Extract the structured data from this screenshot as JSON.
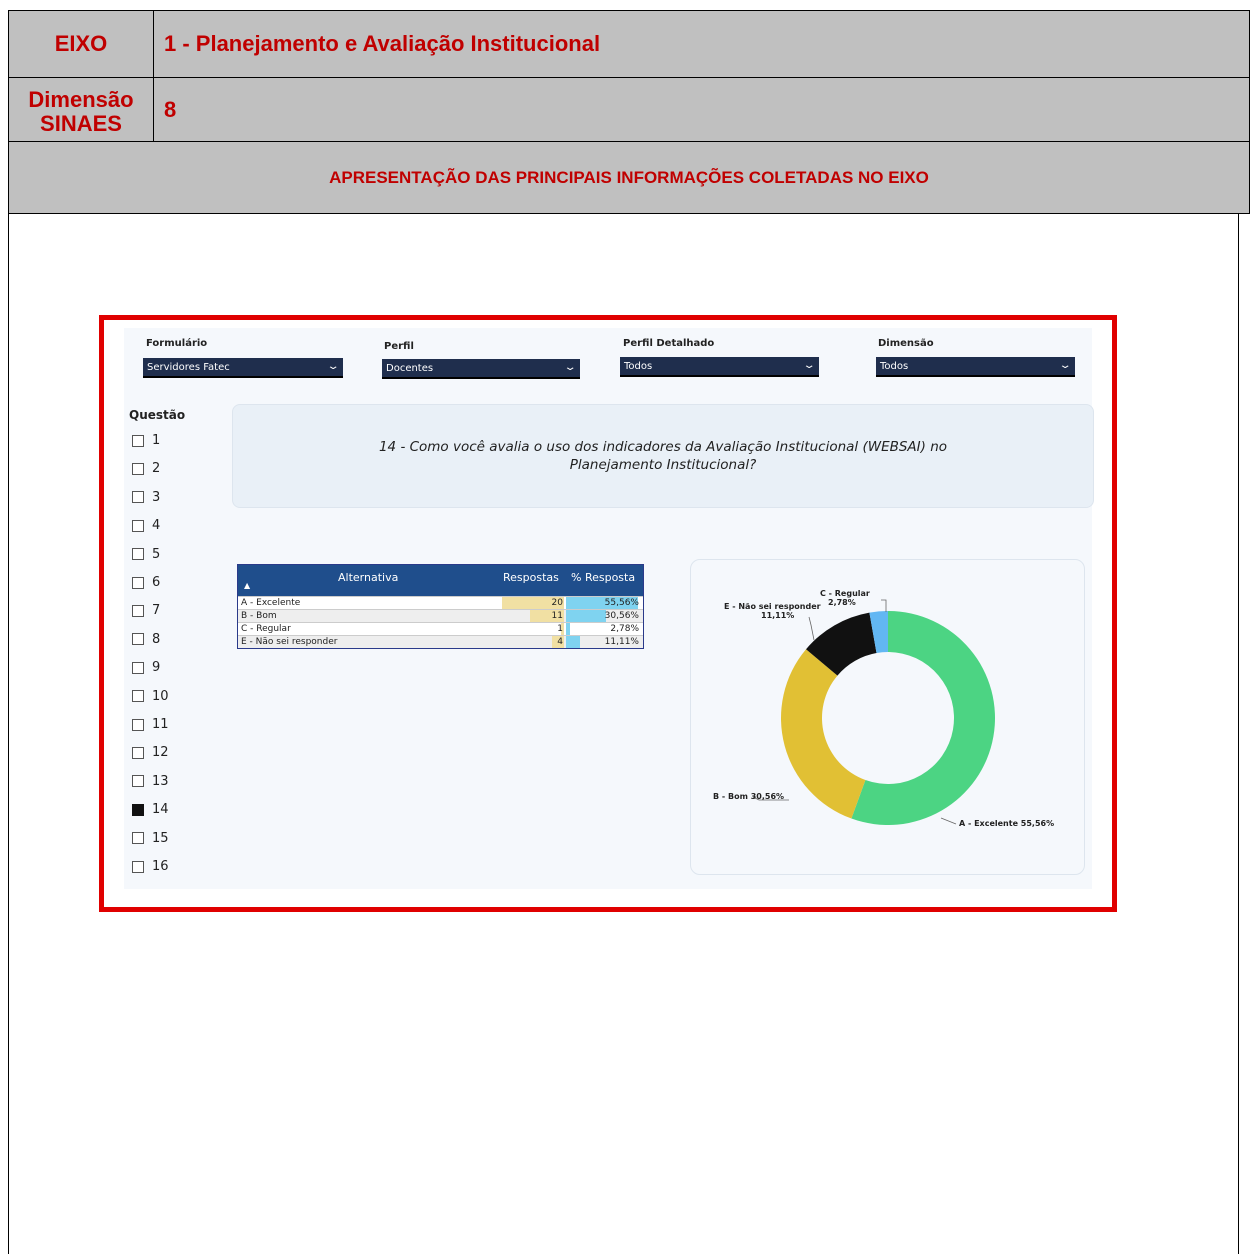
{
  "header": {
    "eixo_label": "EIXO",
    "eixo_value": "1 - Planejamento e Avaliação Institucional",
    "dimensao_label_line1": "Dimensão",
    "dimensao_label_line2": "SINAES",
    "dimensao_value": "8",
    "section_title": "APRESENTAÇÃO DAS PRINCIPAIS INFORMAÇÕES COLETADAS NO EIXO"
  },
  "filters": [
    {
      "label": "Formulário",
      "value": "Servidores Fatec"
    },
    {
      "label": "Perfil",
      "value": "Docentes"
    },
    {
      "label": "Perfil Detalhado",
      "value": "Todos"
    },
    {
      "label": "Dimensão",
      "value": "Todos"
    }
  ],
  "questions": {
    "title": "Questão",
    "items": [
      "1",
      "2",
      "3",
      "4",
      "5",
      "6",
      "7",
      "8",
      "9",
      "10",
      "11",
      "12",
      "13",
      "14",
      "15",
      "16"
    ],
    "selected": "14"
  },
  "question_text": "14 - Como você avalia o uso dos indicadores da Avaliação Institucional (WEBSAI) no Planejamento Institucional?",
  "table": {
    "headers": [
      "Alternativa",
      "Respostas",
      "% Resposta"
    ],
    "rows": [
      {
        "alt": "A - Excelente",
        "resp": "20",
        "pct": "55,56%"
      },
      {
        "alt": "B - Bom",
        "resp": "11",
        "pct": "30,56%"
      },
      {
        "alt": "C - Regular",
        "resp": "1",
        "pct": "2,78%"
      },
      {
        "alt": "E - Não sei responder",
        "resp": "4",
        "pct": "11,11%"
      }
    ]
  },
  "chart_data": {
    "type": "pie",
    "categories": [
      "A - Excelente",
      "B - Bom",
      "C - Regular",
      "E - Não sei responder"
    ],
    "values": [
      55.56,
      30.56,
      2.78,
      11.11
    ],
    "colors": [
      "#4cd483",
      "#e1c034",
      "#62b7f3",
      "#111111"
    ],
    "labels": [
      "A - Excelente 55,56%",
      "B - Bom 30,56%",
      "C - Regular",
      "2,78%",
      "E - Não sei responder",
      "11,11%"
    ]
  }
}
